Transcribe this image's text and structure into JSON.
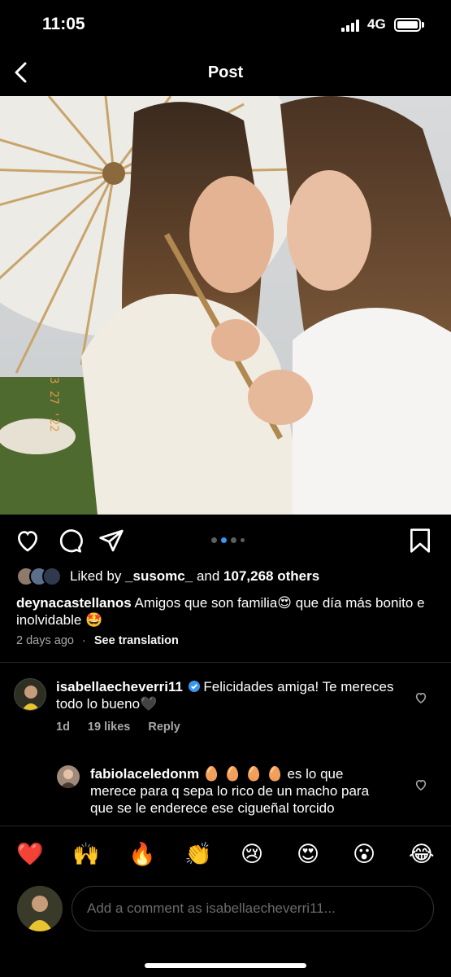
{
  "status_bar": {
    "time": "11:05",
    "network": "4G"
  },
  "nav": {
    "title": "Post"
  },
  "post": {
    "carousel_pages": 4,
    "carousel_active": 2,
    "image_alt": "Two women embracing under a paper parasol",
    "image_stamp": "3 27 '22",
    "liked_by_prefix": "Liked by ",
    "liked_by_user": "_susomc_",
    "liked_by_middle": " and ",
    "liked_by_count": "107,268 others",
    "author": "deynacastellanos",
    "caption_part1": " Amigos que son familia",
    "caption_emoji1": "😍",
    "caption_part2": " que día más bonito e inolvidable ",
    "caption_emoji2": "🤩",
    "time_ago": "2 days ago",
    "separator": "·",
    "see_translation": "See translation"
  },
  "comments": [
    {
      "username": "isabellaecheverri11",
      "verified": true,
      "text": " Felicidades amiga! Te mereces todo lo bueno",
      "emoji": "🖤",
      "time": "1d",
      "likes": "19 likes",
      "reply": "Reply"
    },
    {
      "username": "fabiolaceledonm",
      "emojis": "🥚 🥚 🥚 🥚",
      "text": " es lo que merece para q sepa lo rico de un macho para que se le enderece ese cigueñal torcido"
    }
  ],
  "emoji_bar": [
    "❤️",
    "🙌",
    "🔥",
    "👏",
    "😢",
    "😍",
    "😮",
    "😂"
  ],
  "comment_input": {
    "placeholder": "Add a comment as isabellaecheverri11..."
  },
  "colors": {
    "background": "#000000",
    "accent_blue": "#3897f0",
    "muted": "#a8a8a8",
    "divider": "#262626"
  }
}
